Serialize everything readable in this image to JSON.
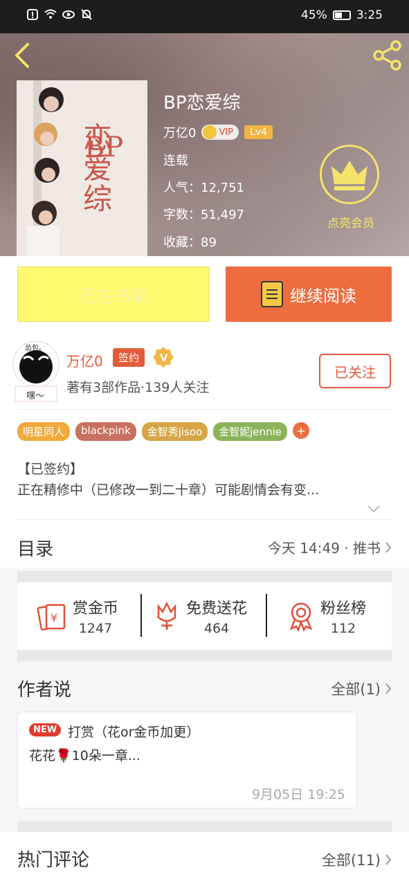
{
  "status_bar": {
    "battery": "45%",
    "time": "3:25"
  },
  "book": {
    "title": "BP恋爱综",
    "author": "万亿0",
    "vip_badge": "VIP",
    "level": "Lv4",
    "status": "连载",
    "popularity": "人气：12,751",
    "word_count": "字数：51,497",
    "favorites": "收藏：89",
    "cover_text": "恋爱综",
    "cover_text_en": "BP"
  },
  "membership": {
    "label": "点亮会员"
  },
  "actions": {
    "shelf": "已在书架",
    "read": "继续阅读"
  },
  "author_panel": {
    "avatar_caption": "嘿～",
    "avatar_top_text": "怂包。",
    "name": "万亿0",
    "signed": "签约",
    "v_badge": "V",
    "stats": "著有3部作品·139人关注",
    "follow": "已关注"
  },
  "tags": [
    {
      "label": "明星同人",
      "color": "#f2a93b"
    },
    {
      "label": "blackpink",
      "color": "#c7715e"
    },
    {
      "label": "金智秀jisoo",
      "color": "#d6a546"
    },
    {
      "label": "金智妮jennie",
      "color": "#8db35a"
    }
  ],
  "tag_more": "+",
  "synopsis": {
    "head": "【已签约】",
    "body": "正在精修中（已修改一到二十章）可能剧情会有变..."
  },
  "toc": {
    "label": "目录",
    "meta": "今天 14:49 · 推书"
  },
  "stats": [
    {
      "label": "赏金币",
      "value": "1247",
      "icon": "coin-envelope-icon"
    },
    {
      "label": "免费送花",
      "value": "464",
      "icon": "flower-icon"
    },
    {
      "label": "粉丝榜",
      "value": "112",
      "icon": "medal-icon"
    }
  ],
  "author_says": {
    "title": "作者说",
    "more": "全部(1)",
    "new_badge": "NEW",
    "note_title": "打赏（花or金币加更）",
    "note_body": "花花🌹10朵一章...",
    "note_time": "9月05日  19:25"
  },
  "comments": {
    "title": "热门评论",
    "more": "全部(11)"
  },
  "colors": {
    "accent": "#ee6d3f",
    "shelf": "#fef86f",
    "gold": "#f5e36b"
  }
}
